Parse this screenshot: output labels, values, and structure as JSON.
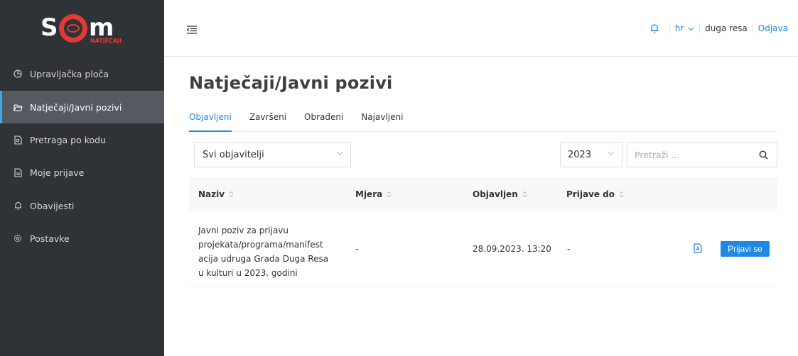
{
  "brand": {
    "logo_text": "SOM",
    "logo_subtext": "NATJEČAJI",
    "colors": {
      "red": "#e53935",
      "sidebar": "#2f3236",
      "active": "#545a60",
      "accent": "#1e88e5"
    }
  },
  "sidebar": {
    "items": [
      {
        "label": "Upravljačka ploča",
        "icon": "pie-chart-icon"
      },
      {
        "label": "Natječaji/Javni pozivi",
        "icon": "folder-open-icon",
        "active": true
      },
      {
        "label": "Pretraga po kodu",
        "icon": "file-search-icon"
      },
      {
        "label": "Moje prijave",
        "icon": "document-icon"
      },
      {
        "label": "Obavijesti",
        "icon": "bell-icon"
      },
      {
        "label": "Postavke",
        "icon": "gear-icon"
      }
    ]
  },
  "topbar": {
    "menu_icon": "menu-collapse-icon",
    "notifications_icon": "bell-icon",
    "language": "hr",
    "user": "duga resa",
    "logout": "Odjava"
  },
  "main": {
    "title": "Natječaji/Javni pozivi",
    "tabs": [
      {
        "label": "Objavljeni",
        "active": true
      },
      {
        "label": "Završeni"
      },
      {
        "label": "Obrađeni"
      },
      {
        "label": "Najavljeni"
      }
    ],
    "filters": {
      "publisher": "Svi objavitelji",
      "year": "2023",
      "search_placeholder": "Pretraži ..."
    },
    "table": {
      "columns": [
        "Naziv",
        "Mjera",
        "Objavljen",
        "Prijave do"
      ],
      "rows": [
        {
          "name_lines": [
            "Javni poziv za prijavu",
            "projekata/programa/manifest",
            "acija udruga Grada Duga Resa",
            "u kulturi u 2023. godini"
          ],
          "measure": "-",
          "published": "28.09.2023. 13:20",
          "deadline": "-",
          "action": "Prijavi se"
        }
      ]
    }
  }
}
